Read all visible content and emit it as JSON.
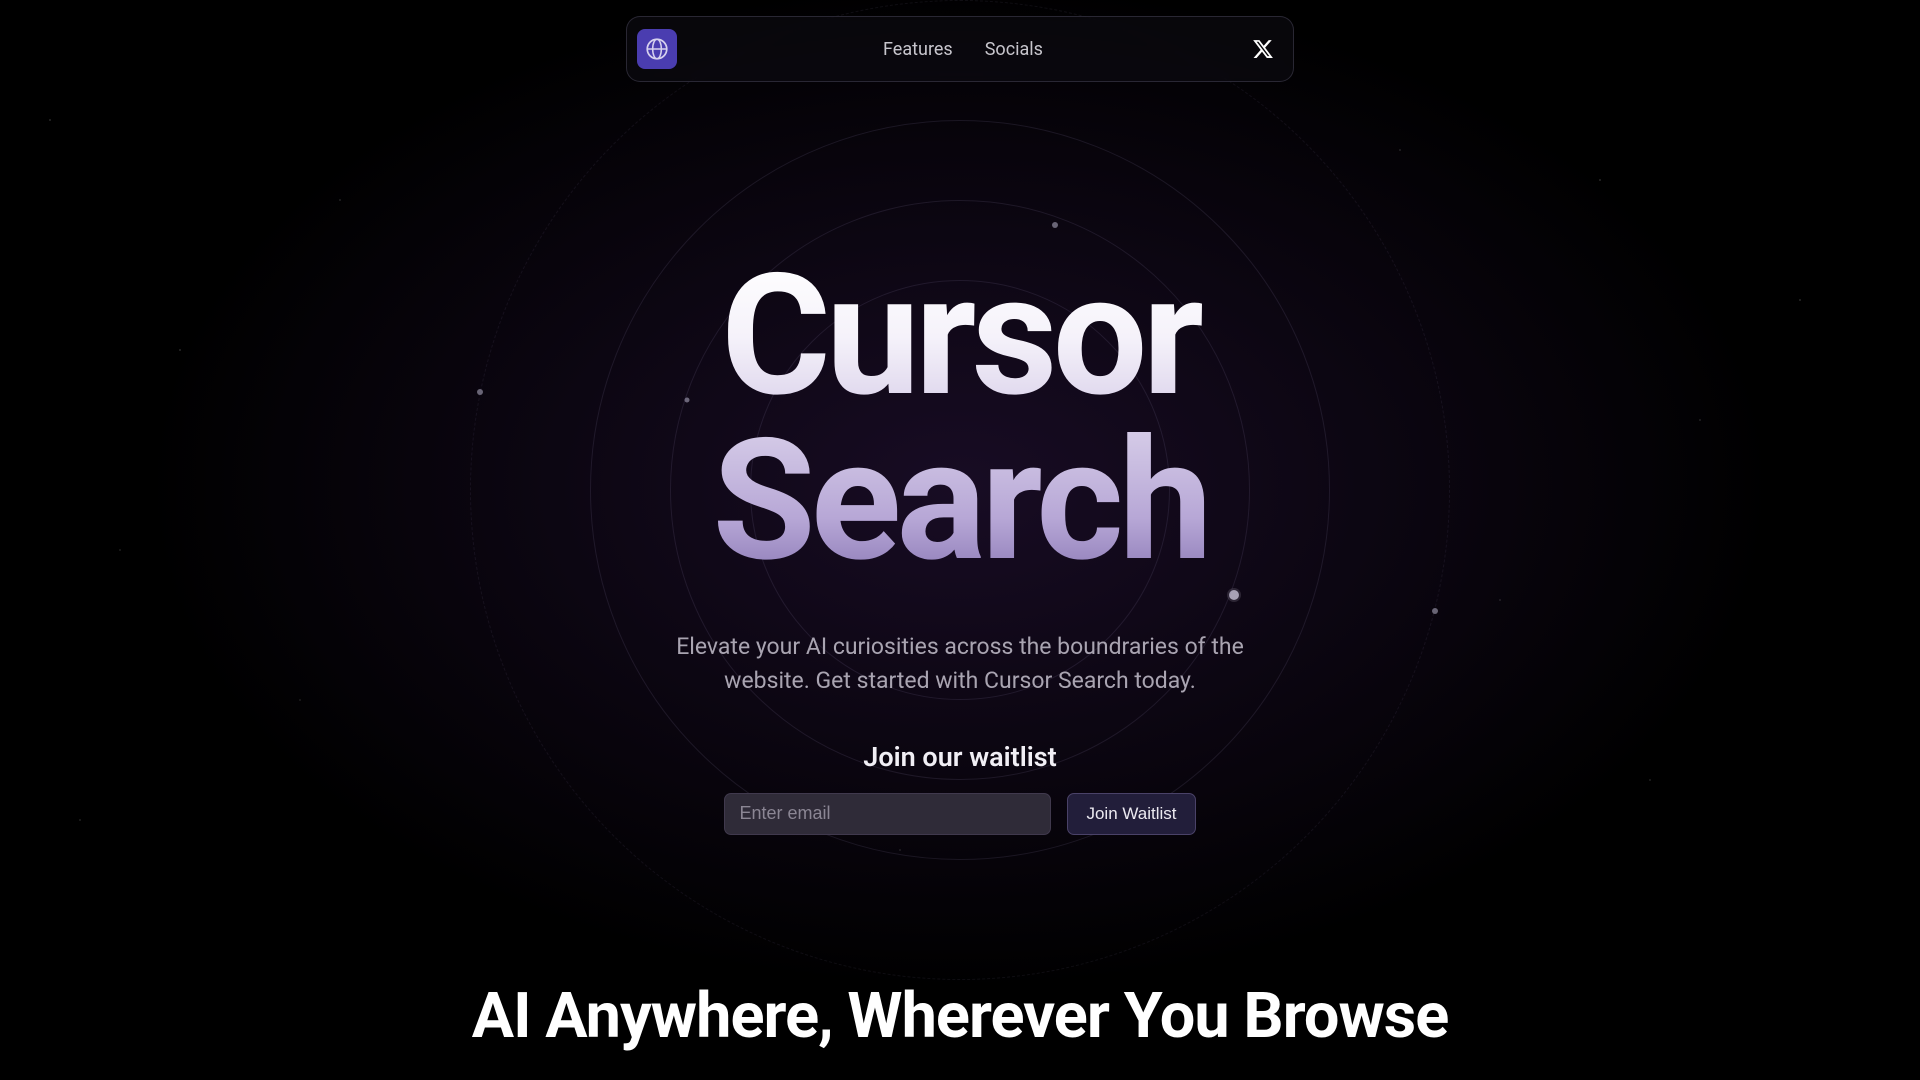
{
  "nav": {
    "items": [
      "Features",
      "Socials"
    ]
  },
  "hero": {
    "title_line1": "Cursor",
    "title_line2": "Search",
    "subtitle": "Elevate your AI curiosities across the boundraries of the website. Get started with Cursor Search today.",
    "waitlist_heading": "Join our waitlist",
    "email_placeholder": "Enter email",
    "join_button": "Join Waitlist"
  },
  "section2": {
    "title": "AI Anywhere, Wherever You Browse"
  }
}
